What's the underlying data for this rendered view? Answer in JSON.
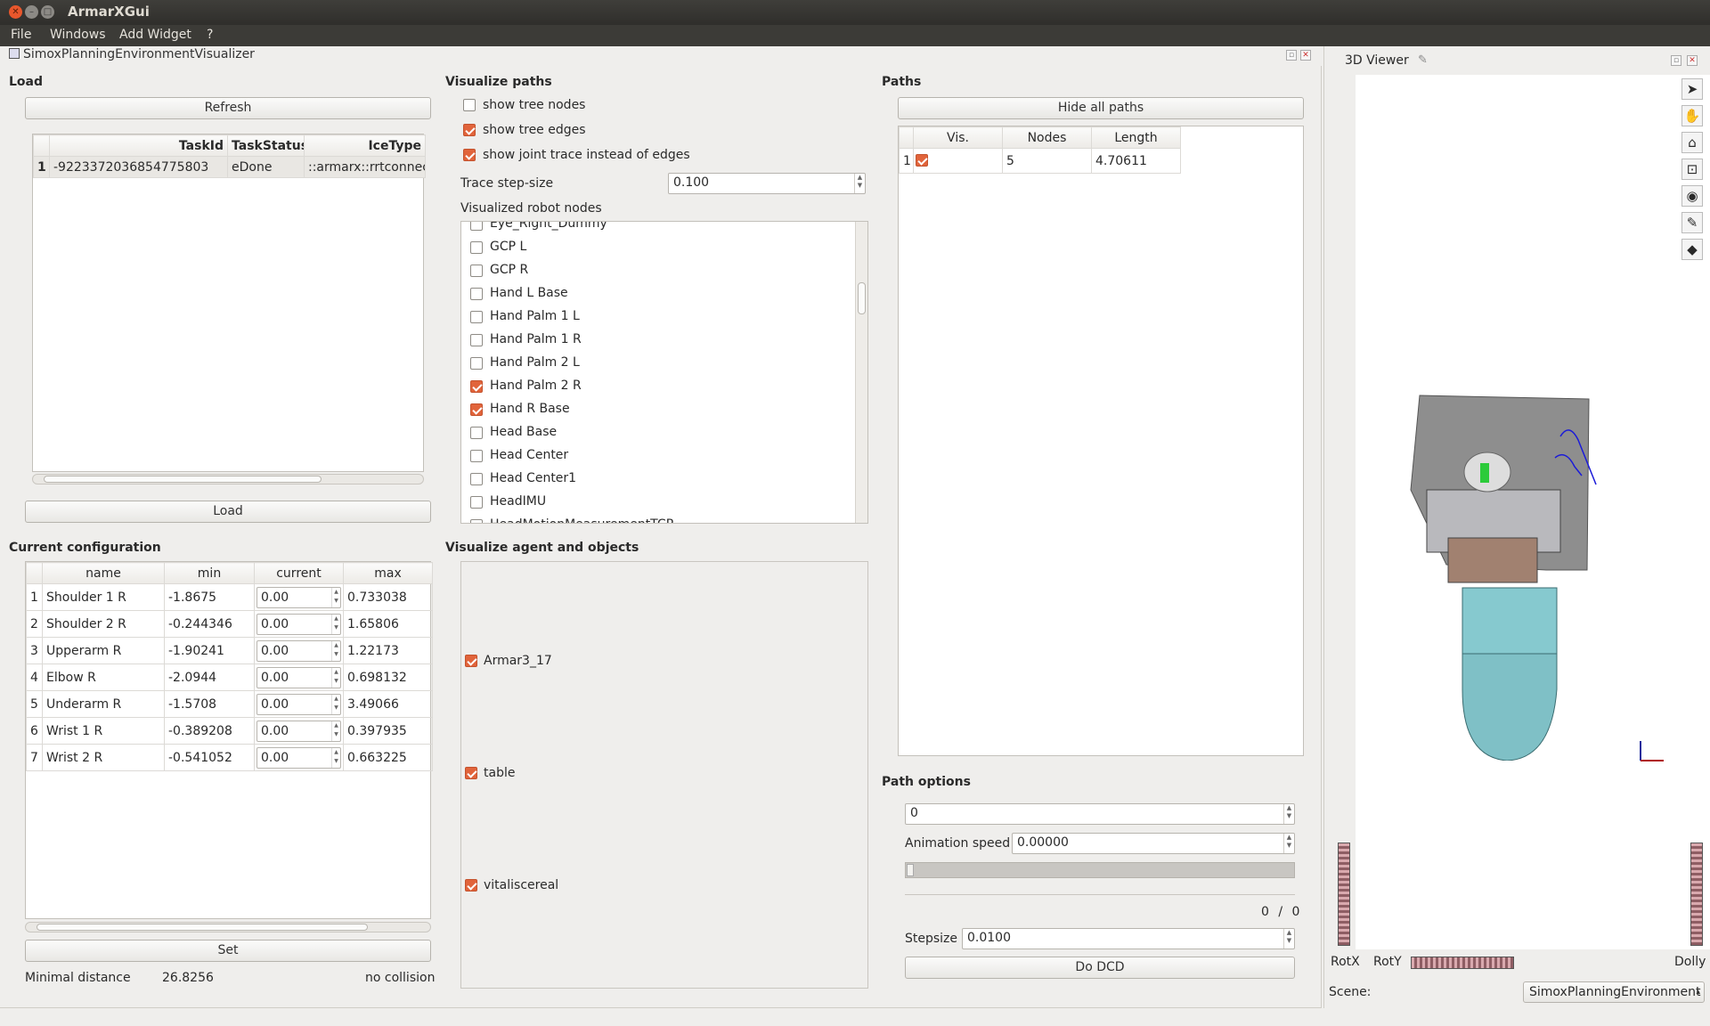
{
  "app": {
    "title": "ArmarXGui"
  },
  "menu": [
    {
      "label": "File"
    },
    {
      "label": "Windows"
    },
    {
      "label": "Add Widget"
    },
    {
      "label": "?"
    }
  ],
  "visualizer": {
    "title": "SimoxPlanningEnvironmentVisualizer",
    "load": {
      "header": "Load",
      "refresh_label": "Refresh",
      "load_label": "Load",
      "columns": [
        "TaskId",
        "TaskStatus",
        "IceType"
      ],
      "rows": [
        {
          "index": "1",
          "task_id": "-9223372036854775803",
          "status": "eDone",
          "ice_type": "::armarx::rrtconnect"
        }
      ]
    },
    "paths_vis": {
      "header": "Visualize paths",
      "show_tree_nodes": "show tree nodes",
      "show_tree_edges": "show tree edges",
      "show_joint_trace": "show joint trace instead of edges",
      "trace_step_label": "Trace step-size",
      "trace_step_value": "0.100",
      "robot_nodes_label": "Visualized robot nodes",
      "nodes": [
        {
          "label": "Eye_Right_Dummy",
          "checked": false
        },
        {
          "label": "GCP L",
          "checked": false
        },
        {
          "label": "GCP R",
          "checked": false
        },
        {
          "label": "Hand L Base",
          "checked": false
        },
        {
          "label": "Hand Palm 1 L",
          "checked": false
        },
        {
          "label": "Hand Palm 1 R",
          "checked": false
        },
        {
          "label": "Hand Palm 2 L",
          "checked": false
        },
        {
          "label": "Hand Palm 2 R",
          "checked": true
        },
        {
          "label": "Hand R Base",
          "checked": true
        },
        {
          "label": "Head Base",
          "checked": false
        },
        {
          "label": "Head Center",
          "checked": false
        },
        {
          "label": "Head Center1",
          "checked": false
        },
        {
          "label": "HeadIMU",
          "checked": false
        },
        {
          "label": "HeadMotionMeasurementTCP",
          "checked": false
        }
      ]
    },
    "paths": {
      "header": "Paths",
      "hide_all_label": "Hide all paths",
      "columns": [
        "Vis.",
        "Nodes",
        "Length"
      ],
      "rows": [
        {
          "index": "1",
          "visible": true,
          "nodes": "5",
          "length": "4.70611"
        }
      ]
    },
    "config": {
      "header": "Current configuration",
      "columns": [
        "name",
        "min",
        "current",
        "max"
      ],
      "rows": [
        {
          "i": "1",
          "name": "Shoulder 1 R",
          "min": "-1.8675",
          "current": "0.00",
          "max": "0.733038"
        },
        {
          "i": "2",
          "name": "Shoulder 2 R",
          "min": "-0.244346",
          "current": "0.00",
          "max": "1.65806"
        },
        {
          "i": "3",
          "name": "Upperarm R",
          "min": "-1.90241",
          "current": "0.00",
          "max": "1.22173"
        },
        {
          "i": "4",
          "name": "Elbow R",
          "min": "-2.0944",
          "current": "0.00",
          "max": "0.698132"
        },
        {
          "i": "5",
          "name": "Underarm R",
          "min": "-1.5708",
          "current": "0.00",
          "max": "3.49066"
        },
        {
          "i": "6",
          "name": "Wrist 1 R",
          "min": "-0.389208",
          "current": "0.00",
          "max": "0.397935"
        },
        {
          "i": "7",
          "name": "Wrist 2 R",
          "min": "-0.541052",
          "current": "0.00",
          "max": "0.663225"
        }
      ],
      "set_label": "Set",
      "min_distance_label": "Minimal distance",
      "min_distance_value": "26.8256",
      "collision_status": "no collision"
    },
    "agents": {
      "header": "Visualize agent and objects",
      "items": [
        {
          "label": "Armar3_17",
          "checked": true
        },
        {
          "label": "table",
          "checked": true
        },
        {
          "label": "vitaliscereal",
          "checked": true
        }
      ]
    },
    "path_options": {
      "header": "Path options",
      "path_index": "0",
      "animation_speed_label": "Animation speed",
      "animation_speed": "0.00000",
      "progress": 0.0,
      "counter_current": "0",
      "counter_sep": "/",
      "counter_total": "0",
      "stepsize_label": "Stepsize",
      "stepsize": "0.0100",
      "dcd_label": "Do DCD"
    }
  },
  "viewer": {
    "title": "3D Viewer",
    "rotx": "RotX",
    "roty": "RotY",
    "dolly": "Dolly",
    "scene_label": "Scene:",
    "scene_value": "SimoxPlanningEnvironment",
    "tools": [
      "select-arrow-icon",
      "hand-pan-icon",
      "home-icon",
      "view-all-icon",
      "eye-icon",
      "pin-icon",
      "cube-icon"
    ]
  },
  "colors": {
    "accent": "#e1643b",
    "titlebar": "#3c3b37",
    "window_bg": "#efeeec"
  }
}
